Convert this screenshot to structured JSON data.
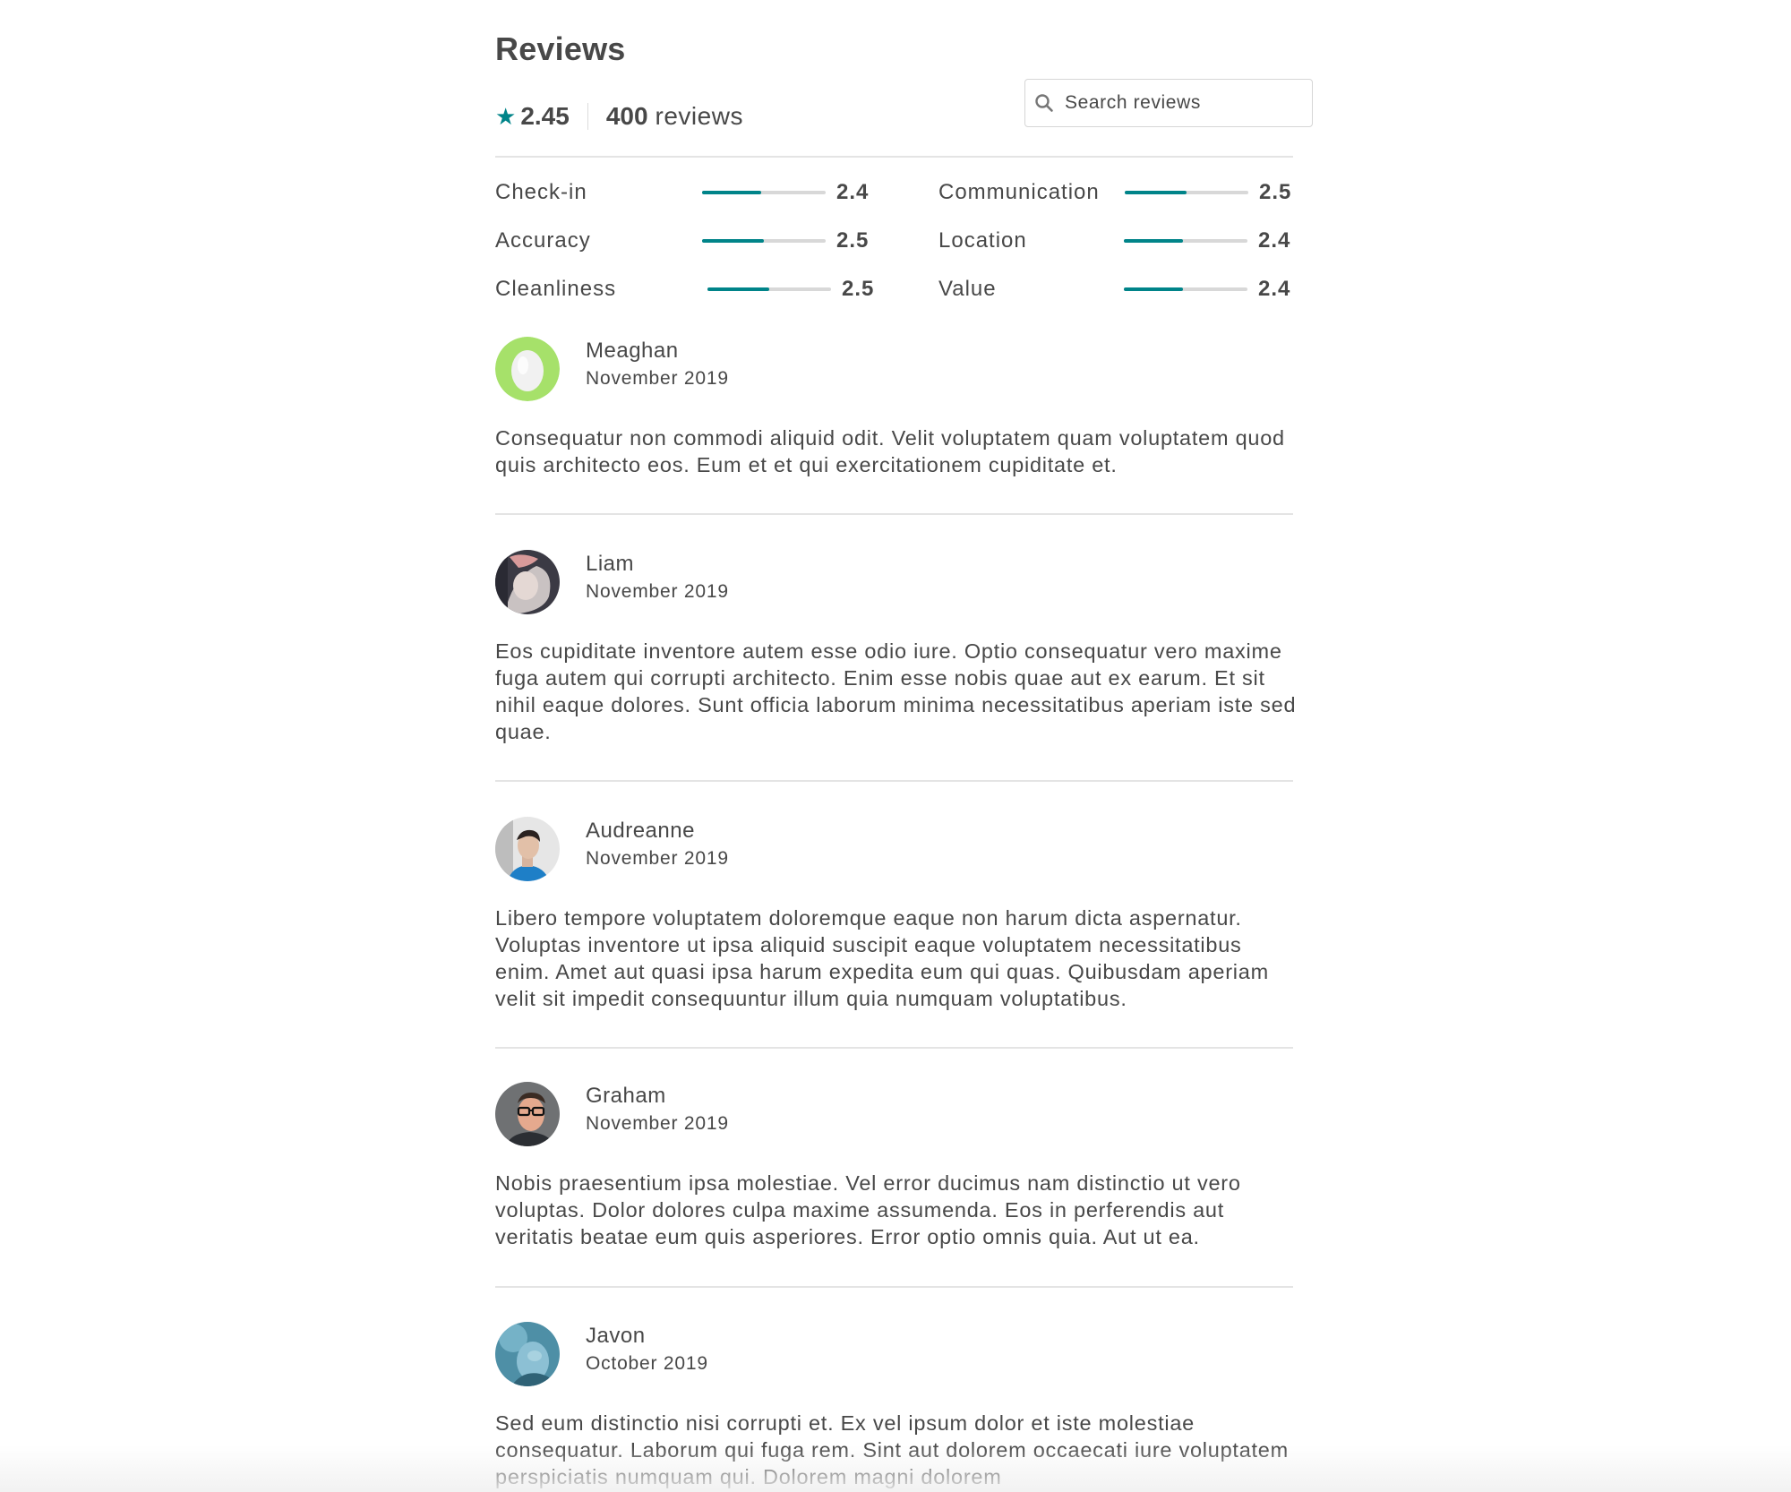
{
  "header": {
    "title": "Reviews",
    "rating": "2.45",
    "review_count": "400",
    "review_count_word": "reviews",
    "star_icon": "star-icon",
    "accent_color": "#008489"
  },
  "search": {
    "placeholder": "Search reviews",
    "value": ""
  },
  "categories": [
    {
      "label": "Check-in",
      "score": "2.4",
      "level": 0.48
    },
    {
      "label": "Accuracy",
      "score": "2.5",
      "level": 0.5
    },
    {
      "label": "Cleanliness",
      "score": "2.5",
      "level": 0.5
    },
    {
      "label": "Communication",
      "score": "2.5",
      "level": 0.5
    },
    {
      "label": "Location",
      "score": "2.4",
      "level": 0.48
    },
    {
      "label": "Value",
      "score": "2.4",
      "level": 0.48
    }
  ],
  "reviews": [
    {
      "name": "Meaghan",
      "date": "November 2019",
      "avatar": "egg-placeholder-avatar",
      "text": "Consequatur non commodi aliquid odit. Velit voluptatem quam voluptatem quod quis architecto eos. Eum et et qui exercitationem cupiditate et."
    },
    {
      "name": "Liam",
      "date": "November 2019",
      "avatar": "photo-avatar",
      "text": "Eos cupiditate inventore autem esse odio iure. Optio consequatur vero maxime fuga autem qui corrupti architecto. Enim esse nobis quae aut ex earum. Et sit nihil eaque dolores. Sunt officia laborum minima necessitatibus aperiam iste sed quae."
    },
    {
      "name": "Audreanne",
      "date": "November 2019",
      "avatar": "photo-avatar",
      "text": "Libero tempore voluptatem doloremque eaque non harum dicta aspernatur. Voluptas inventore ut ipsa aliquid suscipit eaque voluptatem necessitatibus enim. Amet aut quasi ipsa harum expedita eum qui quas. Quibusdam aperiam velit sit impedit consequuntur illum quia numquam voluptatibus."
    },
    {
      "name": "Graham",
      "date": "November 2019",
      "avatar": "photo-avatar",
      "text": "Nobis praesentium ipsa molestiae. Vel error ducimus nam distinctio ut vero voluptas. Dolor dolores culpa maxime assumenda. Eos in perferendis aut veritatis beatae eum quis asperiores. Error optio omnis quia. Aut ut ea."
    },
    {
      "name": "Javon",
      "date": "October 2019",
      "avatar": "photo-avatar",
      "text": "Sed eum distinctio nisi corrupti et. Ex vel ipsum dolor et iste molestiae consequatur. Laborum qui fuga rem. Sint aut dolorem occaecati iure voluptatem perspiciatis numquam qui. Dolorem magni dolorem"
    }
  ]
}
